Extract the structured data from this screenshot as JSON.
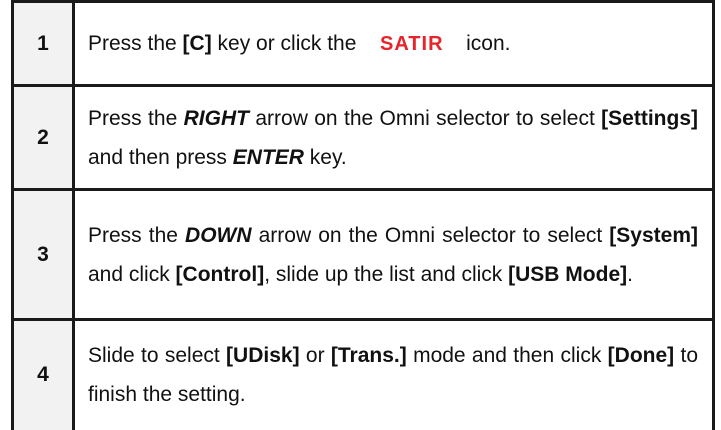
{
  "steps": [
    {
      "num": "1",
      "parts": [
        "Press the ",
        "[C]",
        " key or click the ",
        " icon."
      ],
      "logo": {
        "text": "SATIR",
        "icon": "satir-logo-icon",
        "color": "#e8232a"
      }
    },
    {
      "num": "2",
      "parts": [
        "Press the ",
        "RIGHT",
        " arrow on the Omni selector to select ",
        "[Settings]",
        " and then press ",
        "ENTER",
        " key."
      ]
    },
    {
      "num": "3",
      "parts": [
        "Press the ",
        "DOWN",
        " arrow on the Omni selector to select ",
        "[System]",
        " and click ",
        "[Control]",
        ", slide up the list and click ",
        "[USB Mode]",
        "."
      ]
    },
    {
      "num": "4",
      "parts": [
        "Slide to select ",
        "[UDisk]",
        " or ",
        "[Trans.]",
        " mode and then click ",
        "[Done]",
        " to finish the setting."
      ]
    }
  ]
}
